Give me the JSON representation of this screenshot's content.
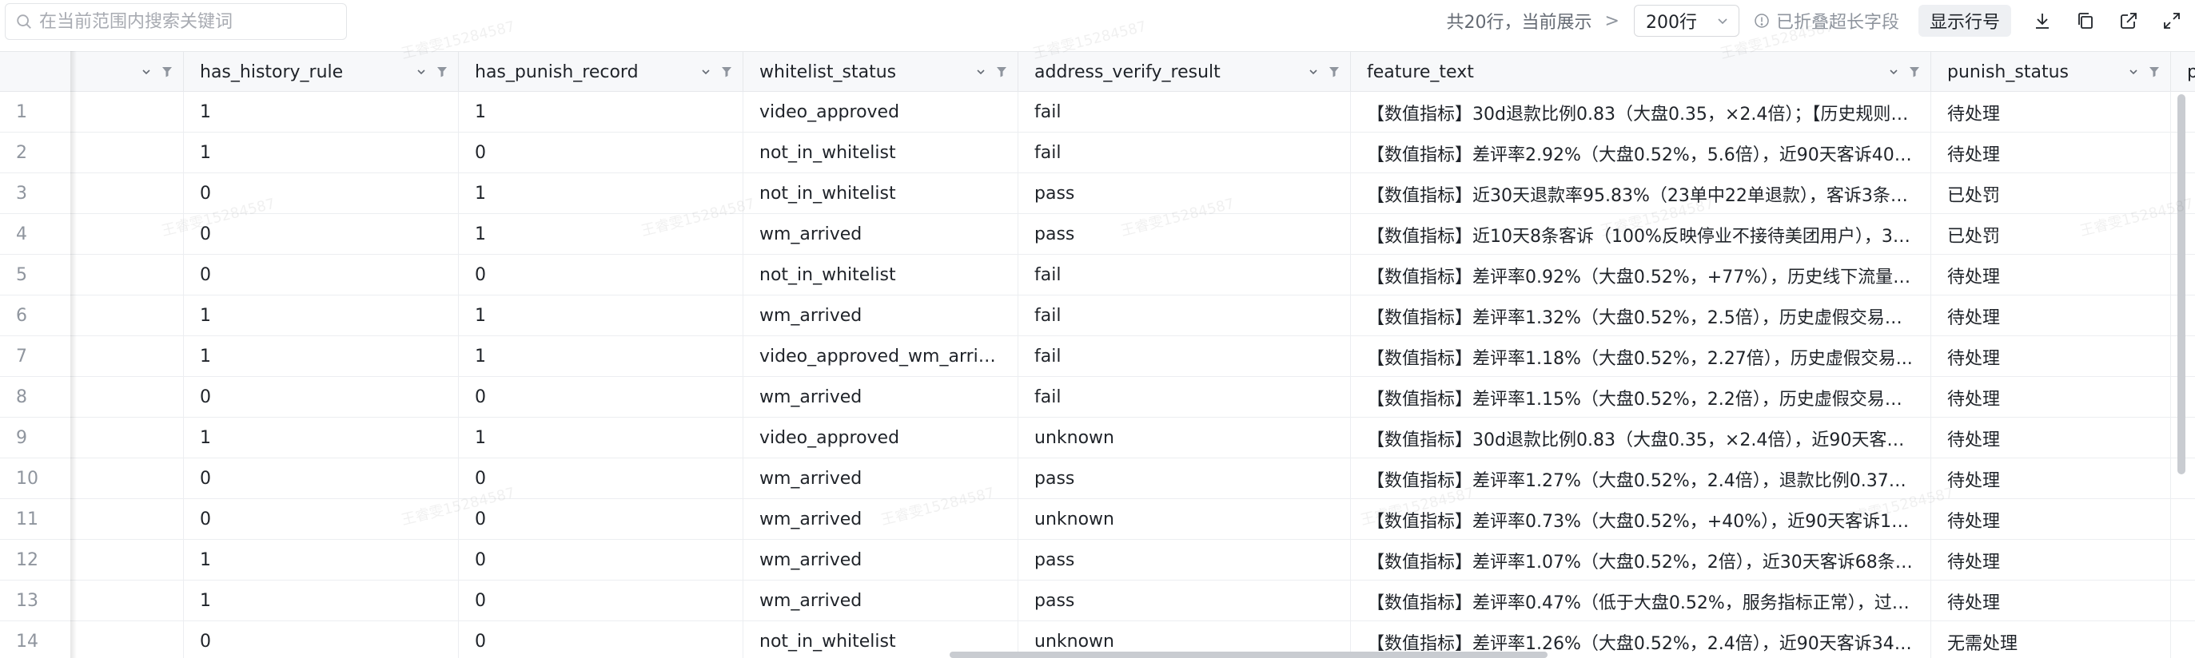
{
  "toolbar": {
    "search_placeholder": "在当前范围内搜索关键词",
    "row_summary": "共20行，当前展示",
    "rows_per_page": "200行",
    "fold_info": "已折叠超长字段",
    "show_row_number": "显示行号"
  },
  "icons": {
    "search": "search-icon",
    "caret": "chevron-down-icon",
    "info": "info-icon",
    "download": "download-icon",
    "copy": "copy-icon",
    "open": "external-link-icon",
    "fullscreen": "expand-icon",
    "sort": "sort-caret-icon",
    "filter": "filter-icon"
  },
  "table": {
    "columns": [
      {
        "label": ""
      },
      {
        "label": "has_history_rule"
      },
      {
        "label": "has_punish_record"
      },
      {
        "label": "whitelist_status"
      },
      {
        "label": "address_verify_result"
      },
      {
        "label": "feature_text"
      },
      {
        "label": "punish_status"
      },
      {
        "label": "p"
      }
    ],
    "rows": [
      {
        "idx": "1",
        "c1": "1",
        "c2": "1",
        "c3": "video_approved",
        "c4": "fail",
        "c5": "【数值指标】30d退款比例0.83（大盘0.35，×2.4倍）；【历史规则】...",
        "c6": "待处理"
      },
      {
        "idx": "2",
        "c1": "1",
        "c2": "0",
        "c3": "not_in_whitelist",
        "c4": "fail",
        "c5": "【数值指标】差评率2.92%（大盘0.52%，5.6倍），近90天客诉40条...",
        "c6": "待处理"
      },
      {
        "idx": "3",
        "c1": "0",
        "c2": "1",
        "c3": "not_in_whitelist",
        "c4": "pass",
        "c5": "【数值指标】近30天退款率95.83%（23单中22单退款），客诉3条（...",
        "c6": "已处罚"
      },
      {
        "idx": "4",
        "c1": "0",
        "c2": "1",
        "c3": "wm_arrived",
        "c4": "pass",
        "c5": "【数值指标】近10天8条客诉（100%反映停业不接待美团用户），30...",
        "c6": "已处罚"
      },
      {
        "idx": "5",
        "c1": "0",
        "c2": "0",
        "c3": "not_in_whitelist",
        "c4": "fail",
        "c5": "【数值指标】差评率0.92%（大盘0.52%，+77%），历史线下流量处...",
        "c6": "待处理"
      },
      {
        "idx": "6",
        "c1": "1",
        "c2": "1",
        "c3": "wm_arrived",
        "c4": "fail",
        "c5": "【数值指标】差评率1.32%（大盘0.52%，2.5倍），历史虚假交易处...",
        "c6": "待处理"
      },
      {
        "idx": "7",
        "c1": "1",
        "c2": "1",
        "c3": "video_approved_wm_arrived",
        "c4": "fail",
        "c5": "【数值指标】差评率1.18%（大盘0.52%，2.27倍），历史虚假交易...",
        "c6": "待处理"
      },
      {
        "idx": "8",
        "c1": "0",
        "c2": "0",
        "c3": "wm_arrived",
        "c4": "fail",
        "c5": "【数值指标】差评率1.15%（大盘0.52%，2.2倍），历史虚假交易处...",
        "c6": "待处理"
      },
      {
        "idx": "9",
        "c1": "1",
        "c2": "1",
        "c3": "video_approved",
        "c4": "unknown",
        "c5": "【数值指标】30d退款比例0.83（大盘0.35，×2.4倍），近90天客诉6...",
        "c6": "待处理"
      },
      {
        "idx": "10",
        "c1": "0",
        "c2": "0",
        "c3": "wm_arrived",
        "c4": "pass",
        "c5": "【数值指标】差评率1.27%（大盘0.52%，2.4倍），退款比例0.37（...",
        "c6": "待处理"
      },
      {
        "idx": "11",
        "c1": "0",
        "c2": "0",
        "c3": "wm_arrived",
        "c4": "unknown",
        "c5": "【数值指标】差评率0.73%（大盘0.52%，+40%），近90天客诉14...",
        "c6": "待处理"
      },
      {
        "idx": "12",
        "c1": "1",
        "c2": "0",
        "c3": "wm_arrived",
        "c4": "pass",
        "c5": "【数值指标】差评率1.07%（大盘0.52%，2倍），近30天客诉68条（...",
        "c6": "待处理"
      },
      {
        "idx": "13",
        "c1": "1",
        "c2": "0",
        "c3": "wm_arrived",
        "c4": "pass",
        "c5": "【数值指标】差评率0.47%（低于大盘0.52%，服务指标正常），过去...",
        "c6": "待处理"
      },
      {
        "idx": "14",
        "c1": "0",
        "c2": "0",
        "c3": "not_in_whitelist",
        "c4": "unknown",
        "c5": "【数值指标】差评率1.26%（大盘0.52%，2.4倍），近90天客诉34条...",
        "c6": "无需处理"
      }
    ]
  },
  "watermark_text": "王睿雯15284587"
}
